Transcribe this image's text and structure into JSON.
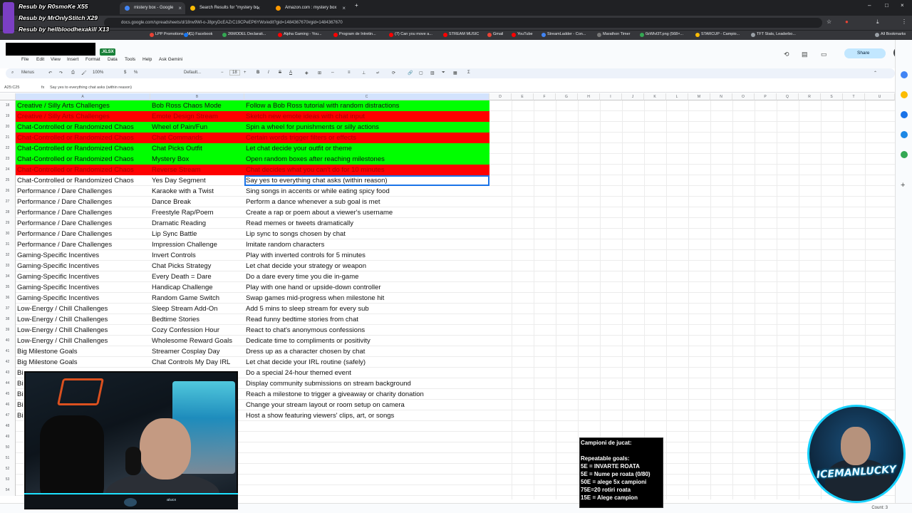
{
  "browser": {
    "tabs": [
      {
        "label": "mistery box - Google Search",
        "color": "#4285f4"
      },
      {
        "label": "Search Results for \"mystery bo",
        "color": "#fbbc05"
      },
      {
        "label": "Amazon.com : mystery box",
        "color": "#ff9900"
      }
    ],
    "new_tab": "+",
    "url": "docs.google.com/spreadsheets/d/18rw9Wl-o-J8pryDcEAZrC19CPeEP6YWo/edit?gid=1484367670#gid=1484367670",
    "bookmarks": [
      "LPP Promotions - M...",
      "(1) Facebook",
      "26MODEL Declarati...",
      "Alpha Gaming - You...",
      "Program de Intretin...",
      "(7) Can you move a...",
      "STREAM MUSIC",
      "Gmail",
      "YouTube",
      "StreamLadder - Con...",
      "Marathon Timer",
      "0zWlvl3T.png (568×...",
      "STARCUP - Campio...",
      "TFT Stats, Leaderbo...",
      "All Bookmarks"
    ]
  },
  "sheets": {
    "file_badge": ".XLSX",
    "menu": [
      "File",
      "Edit",
      "View",
      "Insert",
      "Format",
      "Data",
      "Tools",
      "Help",
      "Ask Gemini"
    ],
    "share_label": "Share",
    "toolbar": {
      "menus": "Menus",
      "zoom": "100%",
      "currency": "$",
      "percent": "%",
      "font": "Default...",
      "font_size": "18"
    },
    "name_box": "A25:C25",
    "formula": "Say yes to everything chat asks (within reason)",
    "columns": [
      "A",
      "B",
      "C",
      "D",
      "E",
      "F",
      "G",
      "H",
      "I",
      "J",
      "K",
      "L",
      "M",
      "N",
      "O",
      "P",
      "Q",
      "R",
      "S",
      "T",
      "U"
    ],
    "rows": [
      {
        "n": "18",
        "style": "green",
        "a": "Creative / Silly Arts Challenges",
        "b": "Bob Ross Chaos Mode",
        "c": "Follow a Bob Ross tutorial with random distractions"
      },
      {
        "n": "19",
        "style": "red",
        "a": "Creative / Silly Arts Challenges",
        "b": "Emote Design Stream",
        "c": "Sketch new emote ideas with chat input"
      },
      {
        "n": "20",
        "style": "green",
        "a": "Chat-Controlled or Randomized Chaos",
        "b": "Wheel of Pain/Fun",
        "c": "Spin a wheel for punishments or silly actions"
      },
      {
        "n": "21",
        "style": "red",
        "a": "Chat-Controlled or Randomized Chaos",
        "b": "Chat Commands",
        "c": "Certain words trigger filters or effects"
      },
      {
        "n": "22",
        "style": "green",
        "a": "Chat-Controlled or Randomized Chaos",
        "b": "Chat Picks Outfit",
        "c": "Let chat decide your outfit or theme"
      },
      {
        "n": "23",
        "style": "green",
        "a": "Chat-Controlled or Randomized Chaos",
        "b": "Mystery Box",
        "c": "Open random boxes after reaching milestones"
      },
      {
        "n": "24",
        "style": "red",
        "a": "Chat-Controlled or Randomized Chaos",
        "b": "Reverse Stream",
        "c": "Chat decides what you can't do for 10 minutes"
      },
      {
        "n": "25",
        "style": "sel",
        "a": "Chat-Controlled or Randomized Chaos",
        "b": "Yes Day Segment",
        "c": "Say yes to everything chat asks (within reason)"
      },
      {
        "n": "26",
        "style": "",
        "a": "Performance / Dare Challenges",
        "b": "Karaoke with a Twist",
        "c": "Sing songs in accents or while eating spicy food"
      },
      {
        "n": "27",
        "style": "",
        "a": "Performance / Dare Challenges",
        "b": "Dance Break",
        "c": "Perform a dance whenever a sub goal is met"
      },
      {
        "n": "28",
        "style": "",
        "a": "Performance / Dare Challenges",
        "b": "Freestyle Rap/Poem",
        "c": "Create a rap or poem about a viewer's username"
      },
      {
        "n": "29",
        "style": "",
        "a": "Performance / Dare Challenges",
        "b": "Dramatic Reading",
        "c": "Read memes or tweets dramatically"
      },
      {
        "n": "30",
        "style": "",
        "a": "Performance / Dare Challenges",
        "b": "Lip Sync Battle",
        "c": "Lip sync to songs chosen by chat"
      },
      {
        "n": "31",
        "style": "",
        "a": "Performance / Dare Challenges",
        "b": "Impression Challenge",
        "c": "Imitate random characters"
      },
      {
        "n": "32",
        "style": "",
        "a": "Gaming-Specific Incentives",
        "b": "Invert Controls",
        "c": "Play with inverted controls for 5 minutes"
      },
      {
        "n": "33",
        "style": "",
        "a": "Gaming-Specific Incentives",
        "b": "Chat Picks Strategy",
        "c": "Let chat decide your strategy or weapon"
      },
      {
        "n": "34",
        "style": "",
        "a": "Gaming-Specific Incentives",
        "b": "Every Death = Dare",
        "c": "Do a dare every time you die in-game"
      },
      {
        "n": "35",
        "style": "",
        "a": "Gaming-Specific Incentives",
        "b": "Handicap Challenge",
        "c": "Play with one hand or upside-down controller"
      },
      {
        "n": "36",
        "style": "",
        "a": "Gaming-Specific Incentives",
        "b": "Random Game Switch",
        "c": "Swap games mid-progress when milestone hit"
      },
      {
        "n": "37",
        "style": "",
        "a": "Low-Energy / Chill Challenges",
        "b": "Sleep Stream Add-On",
        "c": "Add 5 mins to sleep stream for every sub"
      },
      {
        "n": "38",
        "style": "",
        "a": "Low-Energy / Chill Challenges",
        "b": "Bedtime Stories",
        "c": "Read funny bedtime stories from chat"
      },
      {
        "n": "39",
        "style": "",
        "a": "Low-Energy / Chill Challenges",
        "b": "Cozy Confession Hour",
        "c": "React to chat's anonymous confessions"
      },
      {
        "n": "40",
        "style": "",
        "a": "Low-Energy / Chill Challenges",
        "b": "Wholesome Reward Goals",
        "c": "Dedicate time to compliments or positivity"
      },
      {
        "n": "41",
        "style": "",
        "a": "Big Milestone Goals",
        "b": "Streamer Cosplay Day",
        "c": "Dress up as a character chosen by chat"
      },
      {
        "n": "42",
        "style": "",
        "a": "Big Milestone Goals",
        "b": "Chat Controls My Day IRL",
        "c": "Let chat decide your IRL routine (safely)"
      },
      {
        "n": "43",
        "style": "",
        "a": "Bi",
        "b": "m",
        "c": "Do a special 24-hour themed event"
      },
      {
        "n": "44",
        "style": "",
        "a": "Bi",
        "b": "",
        "c": "Display community submissions on stream background"
      },
      {
        "n": "45",
        "style": "",
        "a": "Bi",
        "b": "l",
        "c": "Reach a milestone to trigger a giveaway or charity donation"
      },
      {
        "n": "46",
        "style": "",
        "a": "Bi",
        "b": "",
        "c": "Change your stream layout or room setup on camera"
      },
      {
        "n": "47",
        "style": "",
        "a": "Bi",
        "b": "",
        "c": "Host a show featuring viewers' clips, art, or songs"
      },
      {
        "n": "48",
        "style": "",
        "a": "",
        "b": "",
        "c": ""
      },
      {
        "n": "49",
        "style": "",
        "a": "",
        "b": "",
        "c": ""
      },
      {
        "n": "50",
        "style": "",
        "a": "",
        "b": "",
        "c": ""
      },
      {
        "n": "51",
        "style": "",
        "a": "",
        "b": "",
        "c": ""
      },
      {
        "n": "52",
        "style": "",
        "a": "",
        "b": "",
        "c": ""
      },
      {
        "n": "53",
        "style": "",
        "a": "",
        "b": "",
        "c": ""
      },
      {
        "n": "54",
        "style": "",
        "a": "",
        "b": "",
        "c": ""
      }
    ],
    "status_count": "Count: 3"
  },
  "overlay": {
    "resub_lines": [
      "Resub by R0smoKe X55",
      "Resub by MrOnlyStitch X29",
      "Resub by hellbloodhexakill X13"
    ],
    "goals_title": "Campioni de jucat:",
    "goals_subtitle": "Repeatable goals:",
    "goals": [
      "5E = INVARTE ROATA",
      "5E = Nume pe roata (0/80)",
      "50E = alege 5x campioni",
      "75E=20 rotiri roata",
      "15E = Alege campion"
    ],
    "channel_logo": "ICEMANLUCKY",
    "cam_footer_center": "atucx"
  }
}
